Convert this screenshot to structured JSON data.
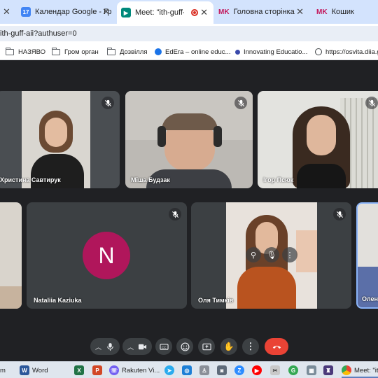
{
  "tabs": [
    {
      "label": "Календар Google - Гр",
      "favicon": "calendar-icon"
    },
    {
      "label": "Meet: \"ith-guff-aii",
      "favicon": "meet-icon",
      "active": true,
      "recording": true
    },
    {
      "label": "Головна сторінка",
      "favicon_text": "MK"
    },
    {
      "label": "Кошик",
      "favicon_text": "MK"
    }
  ],
  "address_bar": {
    "url": "ith-guff-aii?authuser=0"
  },
  "bookmarks": [
    {
      "label": "НАЗЯВО",
      "icon": "folder-icon"
    },
    {
      "label": "Гром орган",
      "icon": "folder-icon"
    },
    {
      "label": "Дозвілля",
      "icon": "folder-icon"
    },
    {
      "label": "EdEra – online educ...",
      "icon": "edera-icon"
    },
    {
      "label": "Innovating Educatio...",
      "icon": "dot-icon"
    },
    {
      "label": "https://osvita.diia.g",
      "icon": "globe-icon"
    }
  ],
  "participants": [
    {
      "name": "Христина Савтирук",
      "muted": true
    },
    {
      "name": "Міша Будзак",
      "muted": true
    },
    {
      "name": "Ігор Псюк",
      "muted": true
    },
    {
      "name": "",
      "muted": false
    },
    {
      "name": "Nataliia Kaziuka",
      "muted": true,
      "avatar_letter": "N",
      "avatar_color": "#b0165b"
    },
    {
      "name": "Оля Тимків",
      "muted": true
    },
    {
      "name": "Олен",
      "muted": false
    }
  ],
  "controls": {
    "items": [
      "chevron-up-icon",
      "mic-icon",
      "chevron-up-icon",
      "camera-icon",
      "captions-icon",
      "emoji-icon",
      "present-icon",
      "raise-hand-icon",
      "more-icon",
      "end-call-icon"
    ],
    "end_color": "#ea4335"
  },
  "taskbar": [
    {
      "label": "m",
      "icon": "app-icon"
    },
    {
      "label": "Word",
      "icon": "word-icon"
    },
    {
      "label": "",
      "icon": "excel-icon"
    },
    {
      "label": "",
      "icon": "powerpoint-icon"
    },
    {
      "label": "Rakuten Vi...",
      "icon": "viber-icon"
    },
    {
      "label": "",
      "icon": "telegram-icon"
    },
    {
      "label": "",
      "icon": "app2-icon"
    },
    {
      "label": "",
      "icon": "app3-icon"
    },
    {
      "label": "",
      "icon": "camera-app-icon"
    },
    {
      "label": "",
      "icon": "z-icon"
    },
    {
      "label": "",
      "icon": "youtube-icon"
    },
    {
      "label": "",
      "icon": "app4-icon"
    },
    {
      "label": "",
      "icon": "g-icon"
    },
    {
      "label": "",
      "icon": "app5-icon"
    },
    {
      "label": "",
      "icon": "app6-icon"
    },
    {
      "label": "Meet: \"ith",
      "icon": "chrome-icon"
    }
  ]
}
